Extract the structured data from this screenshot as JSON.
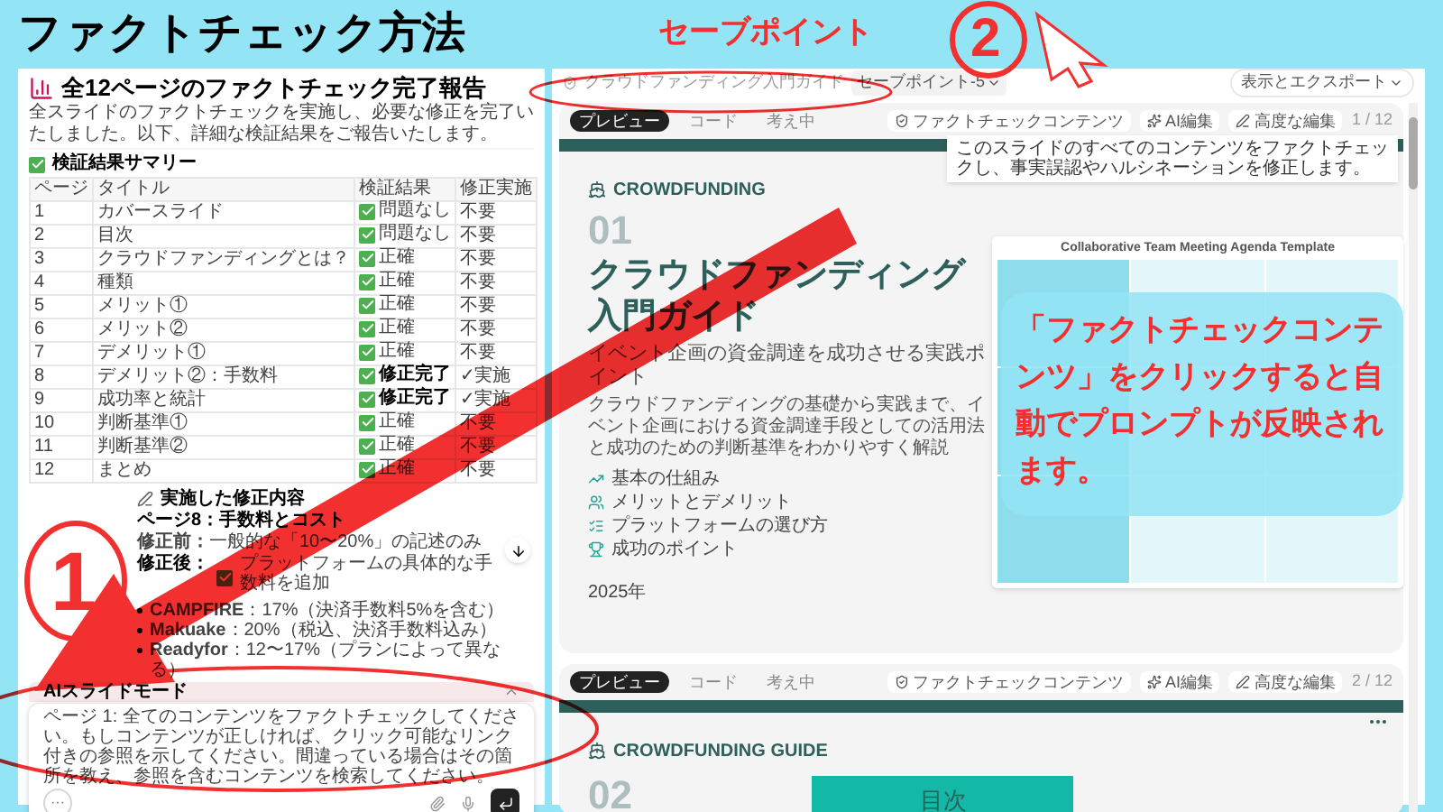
{
  "page_title": "ファクトチェック方法",
  "report": {
    "title": "全12ページのファクトチェック完了報告",
    "intro": "全スライドのファクトチェックを実施し、必要な修正を完了いたしました。以下、詳細な検証結果をご報告いたします。",
    "summary_heading": "検証結果サマリー",
    "columns": [
      "ページ",
      "タイトル",
      "検証結果",
      "修正実施"
    ],
    "rows": [
      {
        "page": "1",
        "title": "カバースライド",
        "result": "問題なし",
        "fixed": false,
        "fix": "不要"
      },
      {
        "page": "2",
        "title": "目次",
        "result": "問題なし",
        "fixed": false,
        "fix": "不要"
      },
      {
        "page": "3",
        "title": "クラウドファンディングとは？",
        "result": "正確",
        "fixed": false,
        "fix": "不要"
      },
      {
        "page": "4",
        "title": "種類",
        "result": "正確",
        "fixed": false,
        "fix": "不要"
      },
      {
        "page": "5",
        "title": "メリット①",
        "result": "正確",
        "fixed": false,
        "fix": "不要"
      },
      {
        "page": "6",
        "title": "メリット②",
        "result": "正確",
        "fixed": false,
        "fix": "不要"
      },
      {
        "page": "7",
        "title": "デメリット①",
        "result": "正確",
        "fixed": false,
        "fix": "不要"
      },
      {
        "page": "8",
        "title": "デメリット②：手数料",
        "result": "修正完了",
        "fixed": true,
        "fix": "✓実施"
      },
      {
        "page": "9",
        "title": "成功率と統計",
        "result": "修正完了",
        "fixed": true,
        "fix": "✓実施"
      },
      {
        "page": "10",
        "title": "判断基準①",
        "result": "正確",
        "fixed": false,
        "fix": "不要"
      },
      {
        "page": "11",
        "title": "判断基準②",
        "result": "正確",
        "fixed": false,
        "fix": "不要"
      },
      {
        "page": "12",
        "title": "まとめ",
        "result": "正確",
        "fixed": false,
        "fix": "不要"
      }
    ],
    "changes_heading": "実施した修正内容",
    "change_page": "ページ8：手数料とコスト",
    "before": "**修正前：**一般的な「10〜20%」の記述のみ",
    "after_label": "修正後：",
    "after": "プラットフォームの具体的な手数料を追加",
    "bullets": [
      "**CAMPFIRE**：17%（決済手数料5%を含む）",
      "**Makuake**：20%（税込、決済手数料込み）",
      "**Readyfor**：12〜17%（プランによって異なる）"
    ]
  },
  "chat": {
    "mode": "AIスライドモード",
    "prompt": "ページ 1: 全てのコンテンツをファクトチェックしてください。もしコンテンツが正しければ、クリック可能なリンク付きの参照を示してください。間違っている場合はその箇所を教え、参照を含むコンテンツを検索してください。",
    "more": "···"
  },
  "topbar": {
    "breadcrumb": "クラウドファンディング入門ガイド",
    "savepoint": "セーブポイント-5",
    "export": "表示とエクスポート"
  },
  "slides": [
    {
      "tabs": [
        {
          "label": "プレビュー",
          "selected": true
        },
        {
          "label": "コード",
          "selected": false
        },
        {
          "label": "考え中",
          "selected": false
        }
      ],
      "actions": [
        "ファクトチェックコンテンツ",
        "AI編集",
        "高度な編集"
      ],
      "counter": "1 / 12",
      "tooltip": "このスライドのすべてのコンテンツをファクトチェックし、事実誤認やハルシネーションを修正します。",
      "kind": "cover",
      "brand": "CROWDFUNDING",
      "number": "01",
      "title": "クラウドファンディング入門ガイド",
      "subtitle": "イベント企画の資金調達を成功させる実践ポイント",
      "description": "クラウドファンディングの基礎から実践まで、イベント企画における資金調達手段としての活用法と成功のための判断基準をわかりやすく解説",
      "items": [
        "基本の仕組み",
        "メリットとデメリット",
        "プラットフォームの選び方",
        "成功のポイント"
      ],
      "year": "2025年",
      "template_title": "Collaborative Team Meeting Agenda Template"
    },
    {
      "tabs": [
        {
          "label": "プレビュー",
          "selected": true
        },
        {
          "label": "コード",
          "selected": false
        },
        {
          "label": "考え中",
          "selected": false
        }
      ],
      "actions": [
        "ファクトチェックコンテンツ",
        "AI編集",
        "高度な編集"
      ],
      "counter": "2 / 12",
      "kind": "toc",
      "brand": "CROWDFUNDING GUIDE",
      "number": "02",
      "title": "目次"
    }
  ],
  "annotations": {
    "savepoint_label": "セーブポイント",
    "step1": "1",
    "step2": "2",
    "caption": "「ファクトチェックコンテンツ」をクリックすると自動でプロンプトが反映されます。"
  }
}
